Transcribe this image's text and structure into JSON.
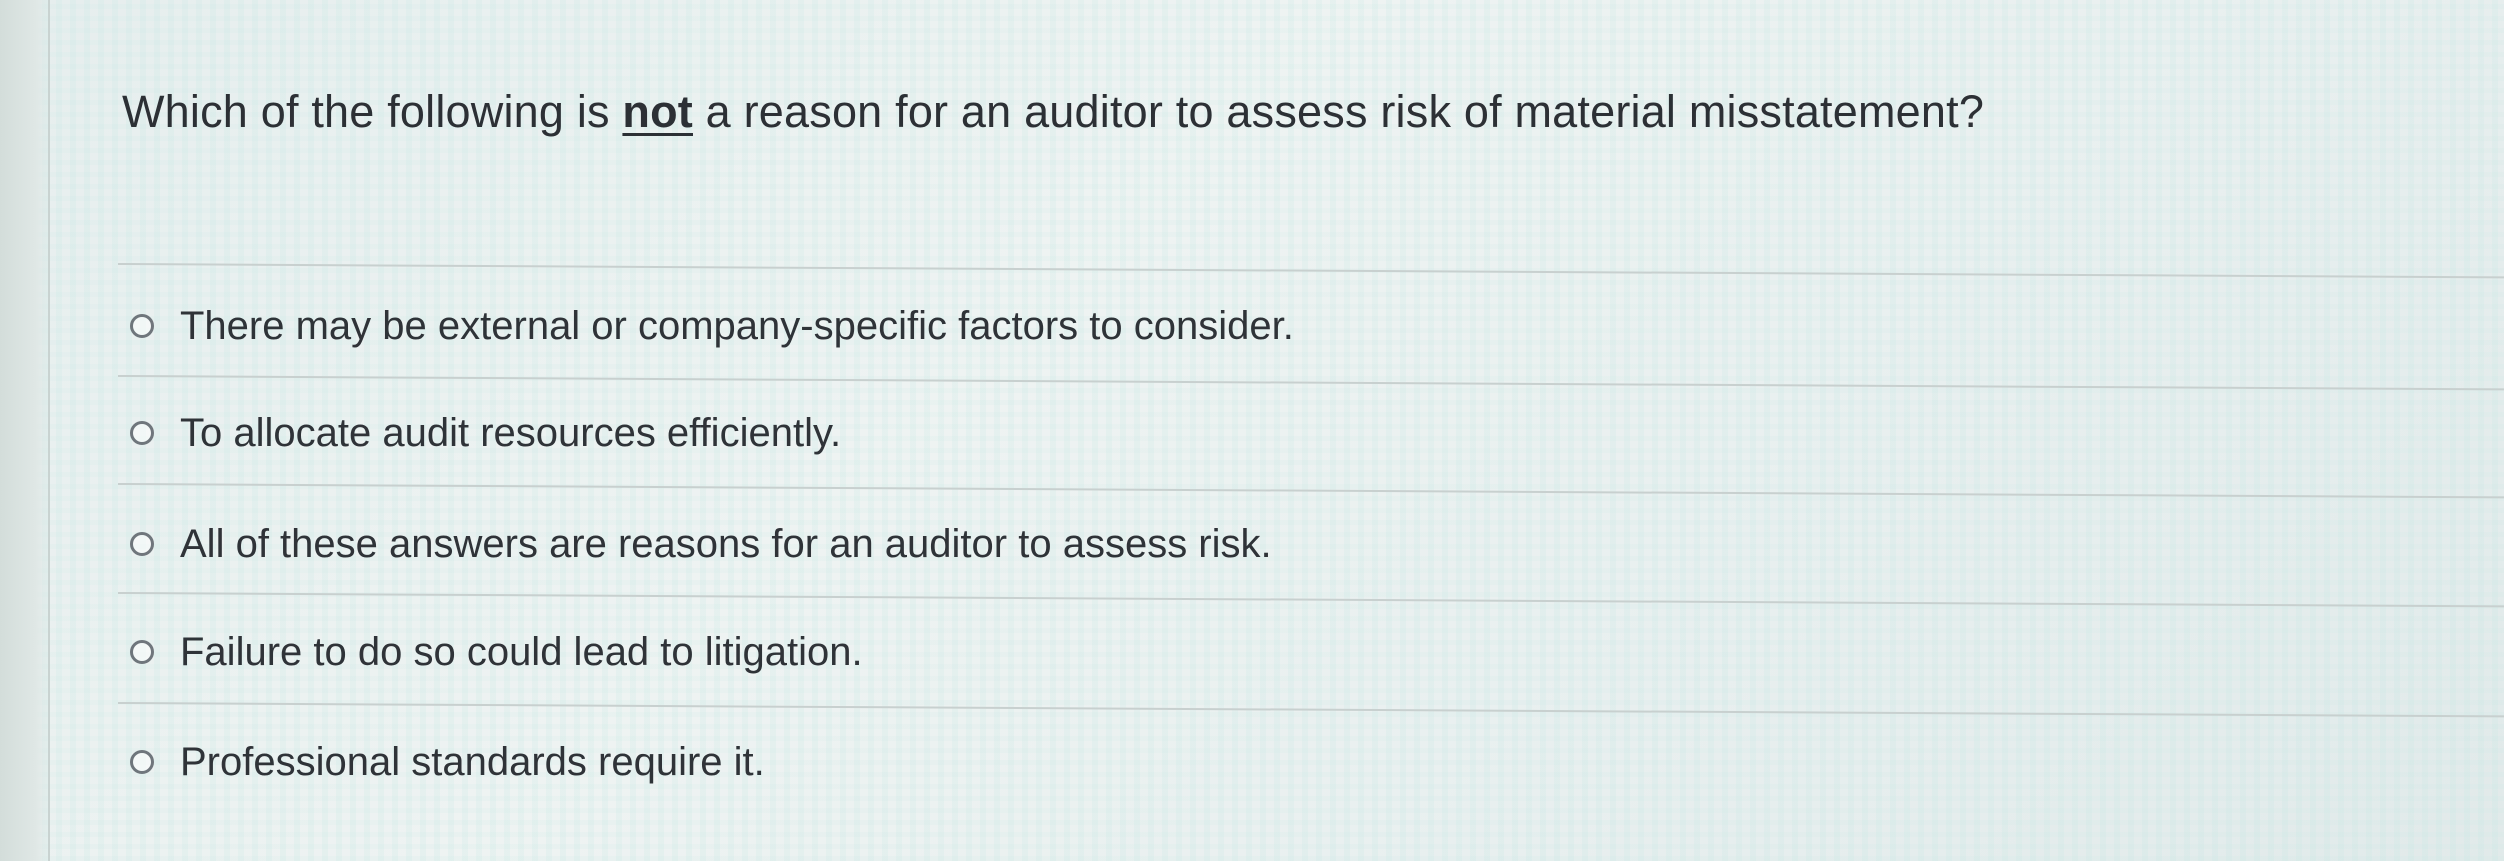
{
  "question": {
    "prefix": "Which of the following is ",
    "emphasis": "not",
    "suffix": " a reason for an auditor to assess risk of material misstatement?"
  },
  "options": [
    {
      "label": "There may be external or company-specific factors to consider.",
      "selected": false
    },
    {
      "label": "To allocate audit resources efficiently.",
      "selected": false
    },
    {
      "label": "All of these answers are reasons for an auditor to assess risk.",
      "selected": false
    },
    {
      "label": "Failure to do so could lead to litigation.",
      "selected": false
    },
    {
      "label": "Professional standards require it.",
      "selected": false
    }
  ],
  "colors": {
    "text": "#2f3338",
    "radio_border": "#6f767c",
    "divider": "#c8d0cf"
  }
}
